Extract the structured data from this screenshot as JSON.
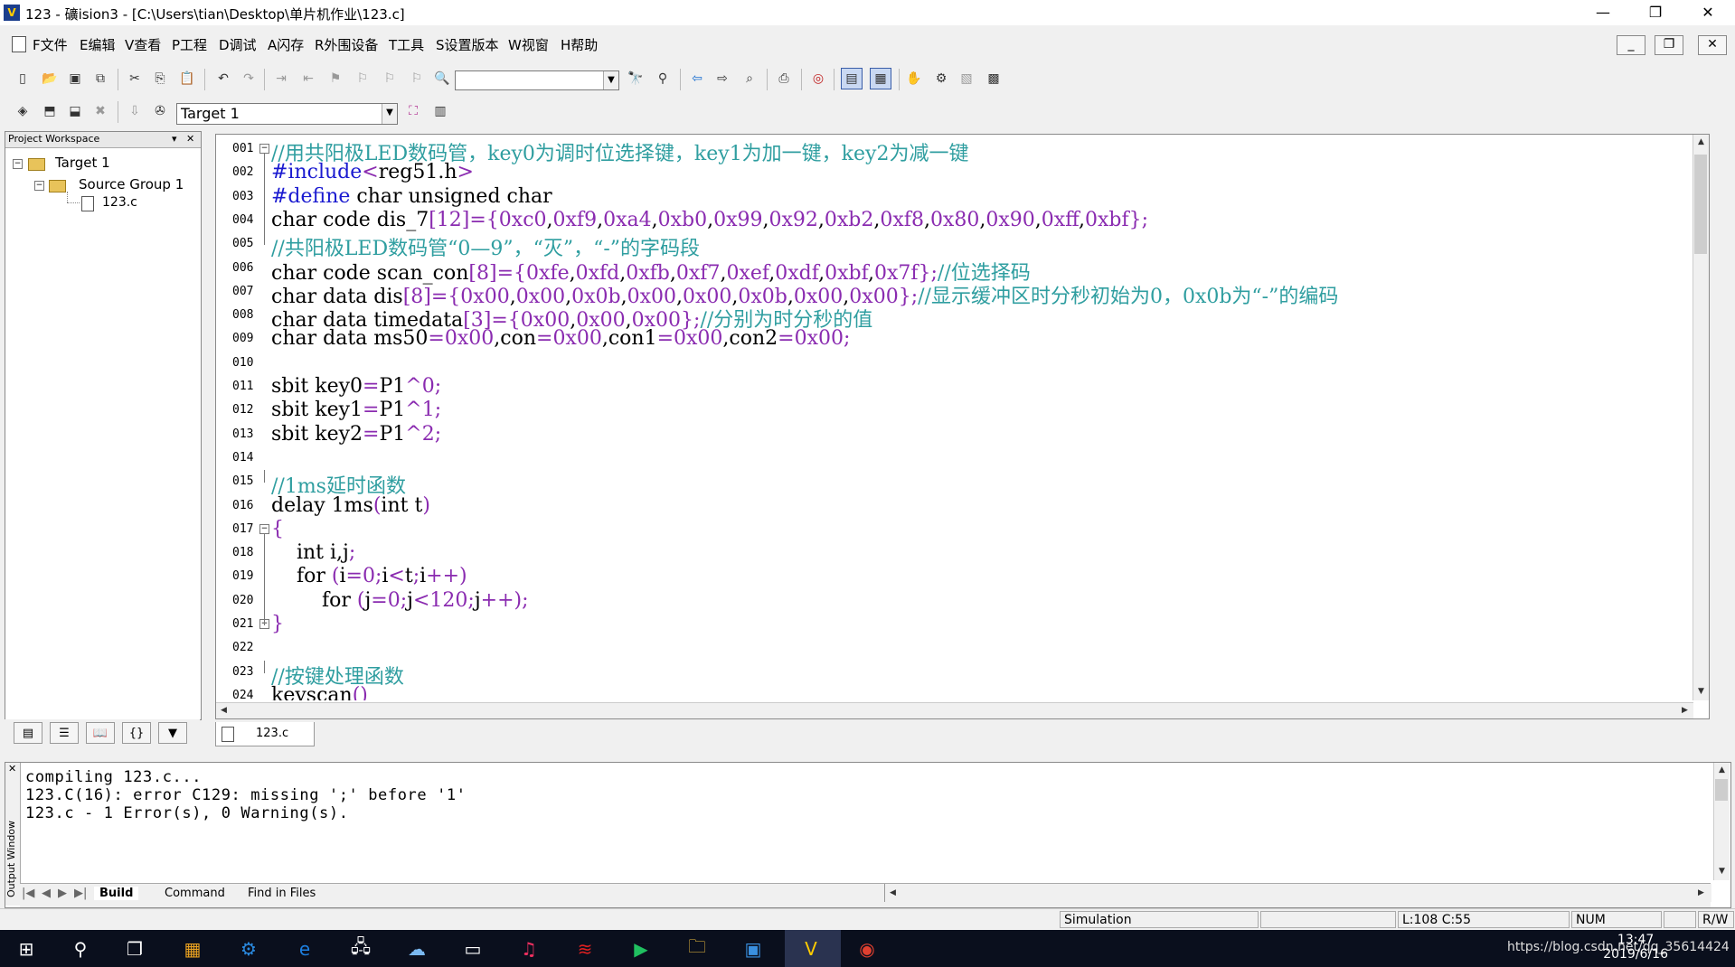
{
  "window": {
    "app_icon": "V",
    "title": "123  - 礦ision3 - [C:\\Users\\tian\\Desktop\\单片机作业\\123.c]",
    "minimize": "—",
    "restore": "❐",
    "close": "✕"
  },
  "menu": {
    "items": [
      "F文件",
      "E编辑",
      "V查看",
      "P工程",
      "D调试",
      "A闪存",
      "R外围设备",
      "T工具",
      "S设置版本",
      "W视窗",
      "H帮助"
    ],
    "mdi_minimize": "_",
    "mdi_restore": "❐",
    "mdi_close": "✕"
  },
  "toolbar": {
    "find_value": "",
    "target_value": "Target 1"
  },
  "project_workspace": {
    "title": "Project Workspace",
    "pin": "▾",
    "close": "✕",
    "root": "Target 1",
    "group": "Source Group 1",
    "file": "123.c",
    "expand_glyph": "−"
  },
  "editor": {
    "line_numbers": [
      "001",
      "002",
      "003",
      "004",
      "005",
      "006",
      "007",
      "008",
      "009",
      "010",
      "011",
      "012",
      "013",
      "014",
      "015",
      "016",
      "017",
      "018",
      "019",
      "020",
      "021",
      "022",
      "023",
      "024"
    ],
    "lines": [
      [
        [
          "c",
          "//用共阳极LED数码管，key0为调时位选择键，key1为加一键，key2为减一键"
        ]
      ],
      [
        [
          "k",
          "#include"
        ],
        [
          "p",
          "<"
        ],
        [
          "t",
          "reg51.h"
        ],
        [
          "p",
          ">"
        ]
      ],
      [
        [
          "k",
          "#define"
        ],
        [
          "t",
          " char unsigned char"
        ]
      ],
      [
        [
          "t",
          "char code dis_7"
        ],
        [
          "p",
          "["
        ],
        [
          "n",
          "12"
        ],
        [
          "p",
          "]={"
        ],
        [
          "n",
          "0xc0"
        ],
        [
          "t",
          ","
        ],
        [
          "n",
          "0xf9"
        ],
        [
          "t",
          ","
        ],
        [
          "n",
          "0xa4"
        ],
        [
          "t",
          ","
        ],
        [
          "n",
          "0xb0"
        ],
        [
          "t",
          ","
        ],
        [
          "n",
          "0x99"
        ],
        [
          "t",
          ","
        ],
        [
          "n",
          "0x92"
        ],
        [
          "t",
          ","
        ],
        [
          "n",
          "0xb2"
        ],
        [
          "t",
          ","
        ],
        [
          "n",
          "0xf8"
        ],
        [
          "t",
          ","
        ],
        [
          "n",
          "0x80"
        ],
        [
          "t",
          ","
        ],
        [
          "n",
          "0x90"
        ],
        [
          "t",
          ","
        ],
        [
          "n",
          "0xff"
        ],
        [
          "t",
          ","
        ],
        [
          "n",
          "0xbf"
        ],
        [
          "p",
          "};"
        ]
      ],
      [
        [
          "c",
          "//共阳极LED数码管“0—9”，“灭”，“-”的字码段"
        ]
      ],
      [
        [
          "t",
          "char code scan_con"
        ],
        [
          "p",
          "["
        ],
        [
          "n",
          "8"
        ],
        [
          "p",
          "]={"
        ],
        [
          "n",
          "0xfe"
        ],
        [
          "t",
          ","
        ],
        [
          "n",
          "0xfd"
        ],
        [
          "t",
          ","
        ],
        [
          "n",
          "0xfb"
        ],
        [
          "t",
          ","
        ],
        [
          "n",
          "0xf7"
        ],
        [
          "t",
          ","
        ],
        [
          "n",
          "0xef"
        ],
        [
          "t",
          ","
        ],
        [
          "n",
          "0xdf"
        ],
        [
          "t",
          ","
        ],
        [
          "n",
          "0xbf"
        ],
        [
          "t",
          ","
        ],
        [
          "n",
          "0x7f"
        ],
        [
          "p",
          "};"
        ],
        [
          "c",
          "//位选择码"
        ]
      ],
      [
        [
          "t",
          "char data dis"
        ],
        [
          "p",
          "["
        ],
        [
          "n",
          "8"
        ],
        [
          "p",
          "]={"
        ],
        [
          "n",
          "0x00"
        ],
        [
          "t",
          ","
        ],
        [
          "n",
          "0x00"
        ],
        [
          "t",
          ","
        ],
        [
          "n",
          "0x0b"
        ],
        [
          "t",
          ","
        ],
        [
          "n",
          "0x00"
        ],
        [
          "t",
          ","
        ],
        [
          "n",
          "0x00"
        ],
        [
          "t",
          ","
        ],
        [
          "n",
          "0x0b"
        ],
        [
          "t",
          ","
        ],
        [
          "n",
          "0x00"
        ],
        [
          "t",
          ","
        ],
        [
          "n",
          "0x00"
        ],
        [
          "p",
          "};"
        ],
        [
          "c",
          "//显示缓冲区时分秒初始为0，0x0b为“-”的编码"
        ]
      ],
      [
        [
          "t",
          "char data timedata"
        ],
        [
          "p",
          "["
        ],
        [
          "n",
          "3"
        ],
        [
          "p",
          "]={"
        ],
        [
          "n",
          "0x00"
        ],
        [
          "t",
          ","
        ],
        [
          "n",
          "0x00"
        ],
        [
          "t",
          ","
        ],
        [
          "n",
          "0x00"
        ],
        [
          "p",
          "};"
        ],
        [
          "c",
          "//分别为时分秒的值"
        ]
      ],
      [
        [
          "t",
          "char data ms50"
        ],
        [
          "p",
          "="
        ],
        [
          "n",
          "0x00"
        ],
        [
          "t",
          ",con"
        ],
        [
          "p",
          "="
        ],
        [
          "n",
          "0x00"
        ],
        [
          "t",
          ",con1"
        ],
        [
          "p",
          "="
        ],
        [
          "n",
          "0x00"
        ],
        [
          "t",
          ",con2"
        ],
        [
          "p",
          "="
        ],
        [
          "n",
          "0x00"
        ],
        [
          "p",
          ";"
        ]
      ],
      [],
      [
        [
          "t",
          "sbit key0"
        ],
        [
          "p",
          "="
        ],
        [
          "t",
          "P1"
        ],
        [
          "p",
          "^"
        ],
        [
          "n",
          "0"
        ],
        [
          "p",
          ";"
        ]
      ],
      [
        [
          "t",
          "sbit key1"
        ],
        [
          "p",
          "="
        ],
        [
          "t",
          "P1"
        ],
        [
          "p",
          "^"
        ],
        [
          "n",
          "1"
        ],
        [
          "p",
          ";"
        ]
      ],
      [
        [
          "t",
          "sbit key2"
        ],
        [
          "p",
          "="
        ],
        [
          "t",
          "P1"
        ],
        [
          "p",
          "^"
        ],
        [
          "n",
          "2"
        ],
        [
          "p",
          ";"
        ]
      ],
      [],
      [
        [
          "c",
          "//1ms延时函数"
        ]
      ],
      [
        [
          "t",
          "delay 1ms"
        ],
        [
          "p",
          "("
        ],
        [
          "t",
          "int t"
        ],
        [
          "p",
          ")"
        ]
      ],
      [
        [
          "p",
          "{"
        ]
      ],
      [
        [
          "t",
          "    int i,j"
        ],
        [
          "p",
          ";"
        ]
      ],
      [
        [
          "t",
          "    for "
        ],
        [
          "p",
          "("
        ],
        [
          "t",
          "i"
        ],
        [
          "p",
          "="
        ],
        [
          "n",
          "0"
        ],
        [
          "p",
          ";"
        ],
        [
          "t",
          "i"
        ],
        [
          "p",
          "<"
        ],
        [
          "t",
          "t"
        ],
        [
          "p",
          ";"
        ],
        [
          "t",
          "i"
        ],
        [
          "p",
          "++)"
        ]
      ],
      [
        [
          "t",
          "        for "
        ],
        [
          "p",
          "("
        ],
        [
          "t",
          "j"
        ],
        [
          "p",
          "="
        ],
        [
          "n",
          "0"
        ],
        [
          "p",
          ";"
        ],
        [
          "t",
          "j"
        ],
        [
          "p",
          "<"
        ],
        [
          "n",
          "120"
        ],
        [
          "p",
          ";"
        ],
        [
          "t",
          "j"
        ],
        [
          "p",
          "++);"
        ]
      ],
      [
        [
          "p",
          "}"
        ]
      ],
      [],
      [
        [
          "c",
          "//按键处理函数"
        ]
      ],
      [
        [
          "t",
          "keyscan"
        ],
        [
          "p",
          "()"
        ]
      ]
    ],
    "file_tab": "123.c"
  },
  "output": {
    "side_label": "Output Window",
    "lines": [
      "compiling 123.c...",
      "123.C(16): error C129: missing ';' before '1'",
      "123.c - 1 Error(s), 0 Warning(s)."
    ],
    "tabs": [
      "Build",
      "Command",
      "Find in Files"
    ]
  },
  "status": {
    "mode": "Simulation",
    "position": "L:108 C:55",
    "num": "NUM",
    "rw": "R/W"
  },
  "taskbar": {
    "url_overlay": "https://blog.csdn.net/qq_35614424",
    "time": "13:47",
    "date": "2019/6/16"
  },
  "colors": {
    "comment": "#2f9ea0",
    "keyword": "#1a1ad0",
    "number": "#8a2bb0",
    "taskbar": "#0a0f1d"
  }
}
